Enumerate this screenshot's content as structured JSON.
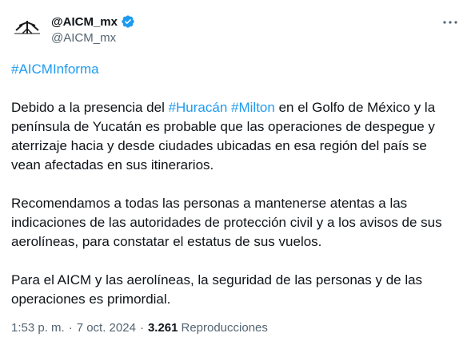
{
  "account": {
    "display_name": "@AICM_mx",
    "handle": "@AICM_mx",
    "verified_color": "#1d9bf0",
    "avatar_icon": "aicm-logo-icon"
  },
  "menu": {
    "icon": "more-horizontal-icon"
  },
  "post": {
    "headline_tag": "#AICMInforma",
    "p1": {
      "a": "Debido a la presencia del ",
      "tag1": "#Huracán",
      "space": " ",
      "tag2": "#Milton",
      "b": " en el Golfo de México y la península de Yucatán es probable que las operaciones de despegue y aterrizaje hacia y desde ciudades ubicadas en esa región del país se vean afectadas en sus itinerarios."
    },
    "p2": "Recomendamos a todas las personas a mantenerse atentas a las indicaciones de las autoridades de protección civil y a los avisos de sus aerolíneas, para constatar el estatus de sus vuelos.",
    "p3": "Para el AICM y las aerolíneas, la seguridad de las personas y de las operaciones es primordial."
  },
  "meta": {
    "time": "1:53 p. m.",
    "dot1": "·",
    "date": "7 oct. 2024",
    "dot2": "·",
    "views": "3.261",
    "views_label": "Reproducciones"
  },
  "colors": {
    "link": "#1d9bf0",
    "secondary": "#536471",
    "text": "#0f1419"
  }
}
